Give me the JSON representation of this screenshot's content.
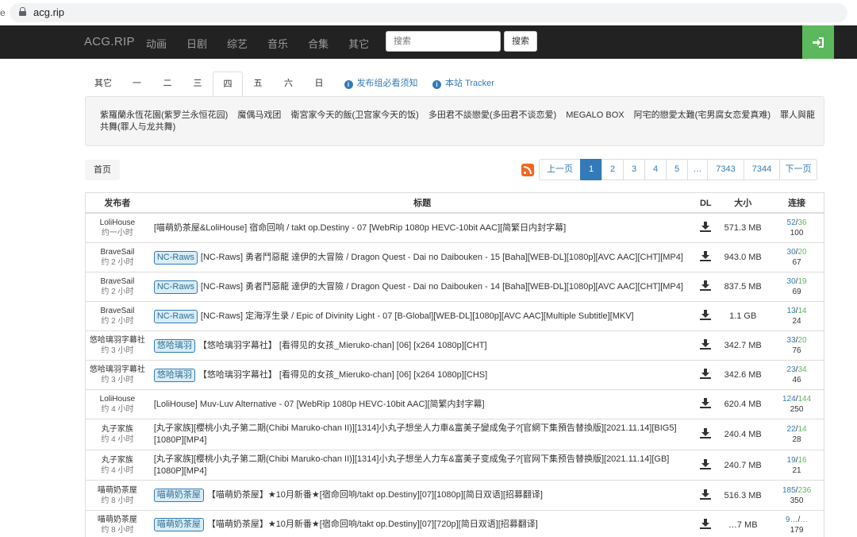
{
  "browser": {
    "url": "acg.rip",
    "edge_fragment": "e"
  },
  "navbar": {
    "brand": "ACG.RIP",
    "links": [
      "动画",
      "日剧",
      "综艺",
      "音乐",
      "合集",
      "其它"
    ],
    "search_placeholder": "搜索",
    "search_button": "搜索"
  },
  "tabs": {
    "days": [
      "其它",
      "一",
      "二",
      "三",
      "四",
      "五",
      "六",
      "日"
    ],
    "active": "四",
    "links": [
      "发布组必看须知",
      "本站 Tracker"
    ]
  },
  "schedule": [
    "紫羅蘭永恆花園(紫罗兰永恒花园)",
    "魔偶马戏团",
    "衛宮家今天的飯(卫宫家今天的饭)",
    "多田君不談戀愛(多田君不谈恋爱)",
    "MEGALO BOX",
    "阿宅的戀愛太難(宅男腐女恋爱真难)",
    "罪人與龍共舞(罪人与龙共舞)"
  ],
  "breadcrumb": "首页",
  "pagination": {
    "prev": "上一页",
    "pages": [
      "1",
      "2",
      "3",
      "4",
      "5",
      "…",
      "7343",
      "7344"
    ],
    "active": "1",
    "next": "下一页"
  },
  "table": {
    "headers": {
      "publisher": "发布者",
      "title": "标题",
      "dl": "DL",
      "size": "大小",
      "connections": "连接"
    },
    "rows": [
      {
        "publisher": "LoliHouse",
        "time": "约一小时",
        "label": "",
        "title": "[喵萌奶茶屋&LoliHouse] 宿命回响 / takt op.Destiny - 07 [WebRip 1080p HEVC-10bit AAC][简繁日内封字幕]",
        "size": "571.3 MB",
        "seeders": "52",
        "leechers": "36",
        "downloads": "100"
      },
      {
        "publisher": "BraveSail",
        "time": "约 2 小时",
        "label": "NC-Raws",
        "title": "[NC-Raws] 勇者鬥惡龍 達伊的大冒險 / Dragon Quest - Dai no Daibouken - 15 [Baha][WEB-DL][1080p][AVC AAC][CHT][MP4]",
        "size": "943.0 MB",
        "seeders": "30",
        "leechers": "20",
        "downloads": "67"
      },
      {
        "publisher": "BraveSail",
        "time": "约 2 小时",
        "label": "NC-Raws",
        "title": "[NC-Raws] 勇者鬥惡龍 達伊的大冒險 / Dragon Quest - Dai no Daibouken - 14 [Baha][WEB-DL][1080p][AVC AAC][CHT][MP4]",
        "size": "837.5 MB",
        "seeders": "30",
        "leechers": "19",
        "downloads": "69"
      },
      {
        "publisher": "BraveSail",
        "time": "约 2 小时",
        "label": "NC-Raws",
        "title": "[NC-Raws] 定海浮生录 / Epic of Divinity Light - 07 [B-Global][WEB-DL][1080p][AVC AAC][Multiple Subtitle][MKV]",
        "size": "1.1 GB",
        "seeders": "13",
        "leechers": "14",
        "downloads": "24"
      },
      {
        "publisher": "悠哈璃羽字幕社",
        "time": "约 3 小时",
        "label": "悠哈璃羽",
        "title": "【悠哈璃羽字幕社】 [看得见的女孩_Mieruko-chan] [06] [x264 1080p][CHT]",
        "size": "342.7 MB",
        "seeders": "33",
        "leechers": "20",
        "downloads": "76"
      },
      {
        "publisher": "悠哈璃羽字幕社",
        "time": "约 3 小时",
        "label": "悠哈璃羽",
        "title": "【悠哈璃羽字幕社】 [看得见的女孩_Mieruko-chan] [06] [x264 1080p][CHS]",
        "size": "342.6 MB",
        "seeders": "23",
        "leechers": "34",
        "downloads": "46"
      },
      {
        "publisher": "LoliHouse",
        "time": "约 4 小时",
        "label": "",
        "title": "[LoliHouse] Muv-Luv Alternative - 07 [WebRip 1080p HEVC-10bit AAC][简繁内封字幕]",
        "size": "620.4 MB",
        "seeders": "124",
        "leechers": "144",
        "downloads": "250"
      },
      {
        "publisher": "丸子家族",
        "time": "约 4 小时",
        "label": "",
        "title": "[丸子家族][櫻桃小丸子第二期(Chibi Maruko-chan II)][1314]小丸子想坐人力車&富美子變成兔子?[官網下集預告替換版][2021.11.14][BIG5][1080P][MP4]",
        "size": "240.4 MB",
        "seeders": "22",
        "leechers": "14",
        "downloads": "28"
      },
      {
        "publisher": "丸子家族",
        "time": "约 4 小时",
        "label": "",
        "title": "[丸子家族][樱桃小丸子第二期(Chibi Maruko-chan II)][1314]小丸子想坐人力车&富美子变成兔子?[官网下集预告替换版][2021.11.14][GB][1080P][MP4]",
        "size": "240.7 MB",
        "seeders": "19",
        "leechers": "16",
        "downloads": "21"
      },
      {
        "publisher": "喵萌奶茶屋",
        "time": "约 8 小时",
        "label": "喵萌奶茶屋",
        "title": "【喵萌奶茶屋】★10月新番★[宿命回响/takt op.Destiny][07][1080p][简日双语][招募翻译]",
        "size": "516.3 MB",
        "seeders": "185",
        "leechers": "236",
        "downloads": "350"
      },
      {
        "publisher": "喵萌奶茶屋",
        "time": "约 8 小时",
        "label": "喵萌奶茶屋",
        "title": "【喵萌奶茶屋】★10月新番★[宿命回响/takt op.Destiny][07][720p][简日双语][招募翻译]",
        "size": "…7 MB",
        "seeders": "9…",
        "leechers": "…",
        "downloads": "179"
      }
    ]
  },
  "colors": {
    "navbar": "#222222",
    "login": "#5cb85c",
    "link": "#337ab7"
  }
}
